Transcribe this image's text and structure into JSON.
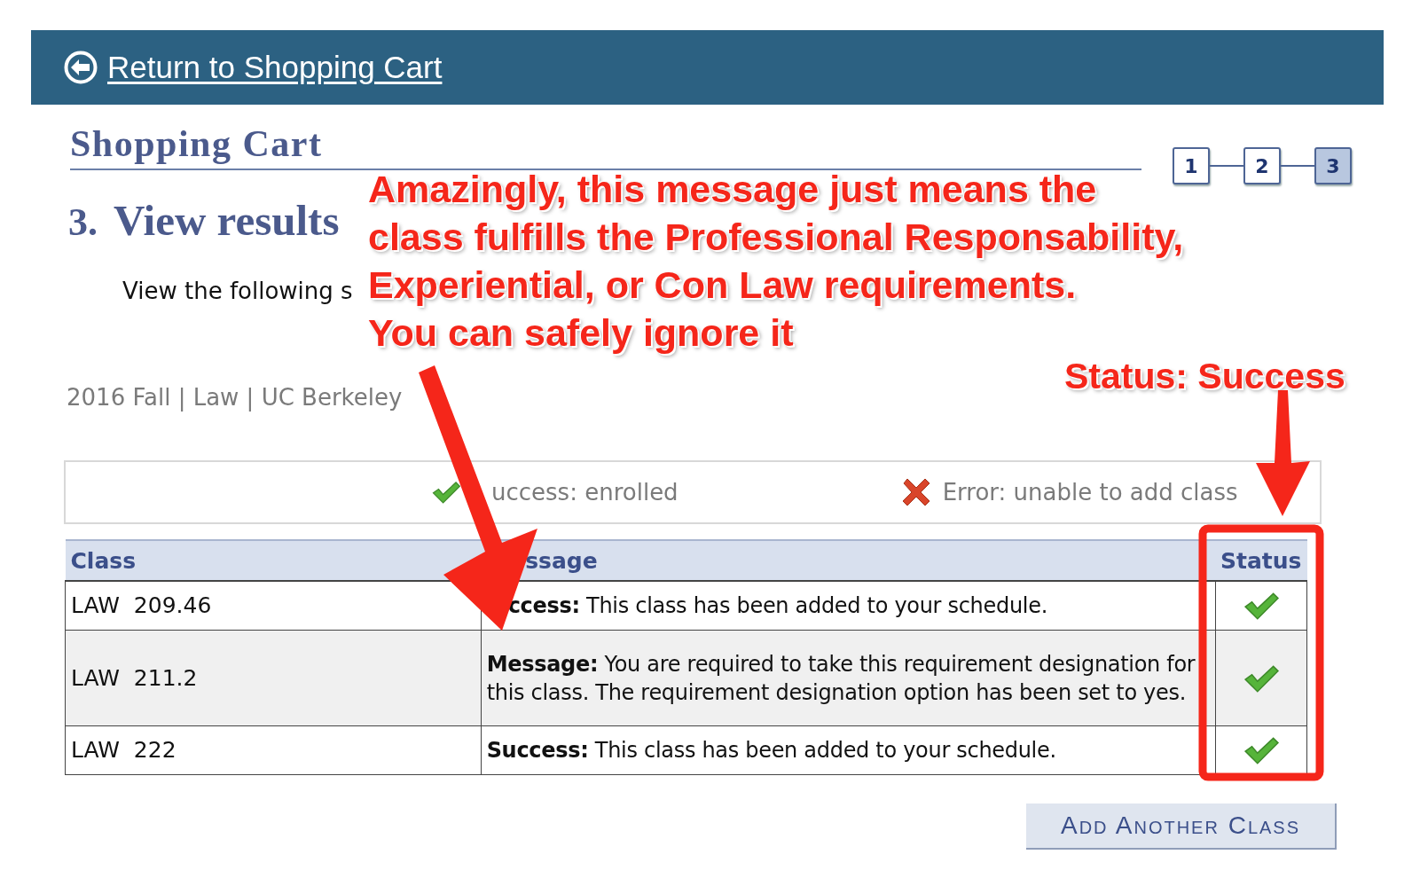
{
  "header": {
    "link": "Return to Shopping Cart"
  },
  "page_title": "Shopping Cart",
  "steps": [
    {
      "label": "1",
      "selected": false
    },
    {
      "label": "2",
      "selected": false
    },
    {
      "label": "3",
      "selected": true
    }
  ],
  "step_heading": {
    "number": "3.",
    "title": "View results"
  },
  "instruction": "View the following s",
  "term": "2016 Fall | Law | UC Berkeley",
  "legend": [
    {
      "kind": "success",
      "label": "uccess: enrolled"
    },
    {
      "kind": "error",
      "label": "Error: unable to add class"
    }
  ],
  "table": {
    "columns": [
      "Class",
      "ssage",
      "Status"
    ],
    "rows": [
      {
        "class": "LAW  209.46",
        "message": "**ccess:** This class has been added to your schedule.",
        "kind": "success"
      },
      {
        "class": "LAW  211.2",
        "message": "**Message:** You are required to take this requirement designation for this class. The requirement designation option has been set to yes.",
        "kind": "success"
      },
      {
        "class": "LAW  222",
        "message": "**Success:** This class has been added to your schedule.",
        "kind": "success"
      }
    ]
  },
  "button": "Add Another Class",
  "annotations": {
    "note": [
      "Amazingly, this message just means the",
      "class fulfills the Professional Responsability,",
      "Experiential, or Con Law requirements.",
      "You can safely ignore it"
    ],
    "status_label": "Status: Success"
  }
}
